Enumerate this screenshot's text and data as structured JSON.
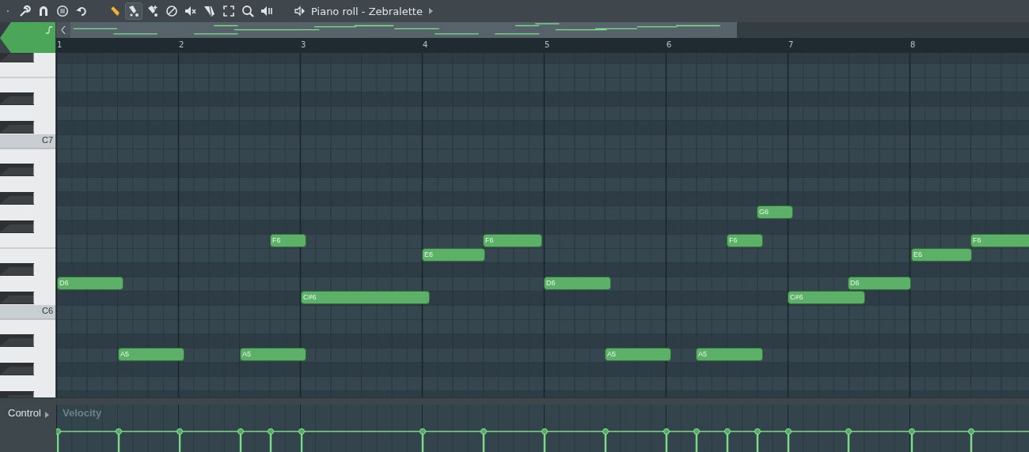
{
  "toolbar": {
    "tools": [
      {
        "kind": "menu",
        "selected": false
      },
      {
        "kind": "wrench",
        "selected": false
      },
      {
        "kind": "magnet",
        "selected": false
      },
      {
        "kind": "list",
        "selected": false
      },
      {
        "kind": "undo",
        "selected": false
      },
      {
        "kind": "pencil",
        "selected": false
      },
      {
        "kind": "brush",
        "selected": true
      },
      {
        "kind": "eraser",
        "selected": false
      },
      {
        "kind": "forbid",
        "selected": false
      },
      {
        "kind": "mute",
        "selected": false
      },
      {
        "kind": "slice",
        "selected": false
      },
      {
        "kind": "select",
        "selected": false
      },
      {
        "kind": "zoom",
        "selected": false
      },
      {
        "kind": "playback",
        "selected": false
      }
    ],
    "title": "Piano roll - Zebralette"
  },
  "ruler": {
    "bars": [
      "1",
      "2",
      "3",
      "4",
      "5",
      "6",
      "7",
      "8"
    ]
  },
  "keyboard": {
    "labels": [
      "C7",
      "C6"
    ]
  },
  "notes": [
    {
      "label": "D6"
    },
    {
      "label": "A5"
    },
    {
      "label": "A5"
    },
    {
      "label": "F6"
    },
    {
      "label": "C#6"
    },
    {
      "label": "E6"
    },
    {
      "label": "F6"
    },
    {
      "label": "D6"
    },
    {
      "label": "A5"
    },
    {
      "label": "A5"
    },
    {
      "label": "F6"
    },
    {
      "label": "G6"
    },
    {
      "label": "C#6"
    },
    {
      "label": "D6"
    },
    {
      "label": "E6"
    },
    {
      "label": "F6"
    }
  ],
  "control": {
    "label": "Control",
    "parameter": "Velocity"
  }
}
